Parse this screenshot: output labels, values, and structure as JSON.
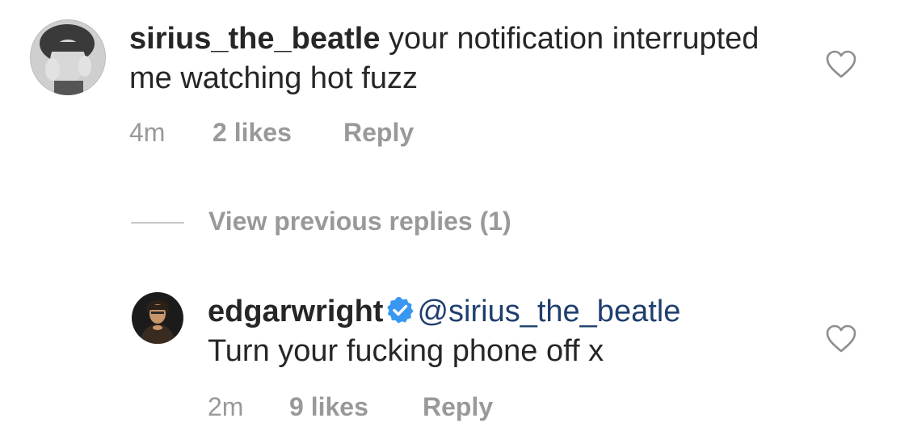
{
  "comment": {
    "username": "sirius_the_beatle",
    "text": " your notification interrupted me watching hot fuzz",
    "time": "4m",
    "likes": "2 likes",
    "reply_label": "Reply",
    "avatar_icon": "user-avatar-photo"
  },
  "thread": {
    "view_previous_label": "View previous replies (1)"
  },
  "reply": {
    "username": "edgarwright",
    "verified_icon": "verified-badge-icon",
    "mention": "@sirius_the_beatle",
    "text": "Turn your fucking phone off x",
    "time": "2m",
    "likes": "9 likes",
    "reply_label": "Reply",
    "avatar_icon": "user-avatar-photo"
  },
  "colors": {
    "text": "#262626",
    "meta": "#999999",
    "mention": "#1f3f6e",
    "verified": "#3897f0"
  }
}
